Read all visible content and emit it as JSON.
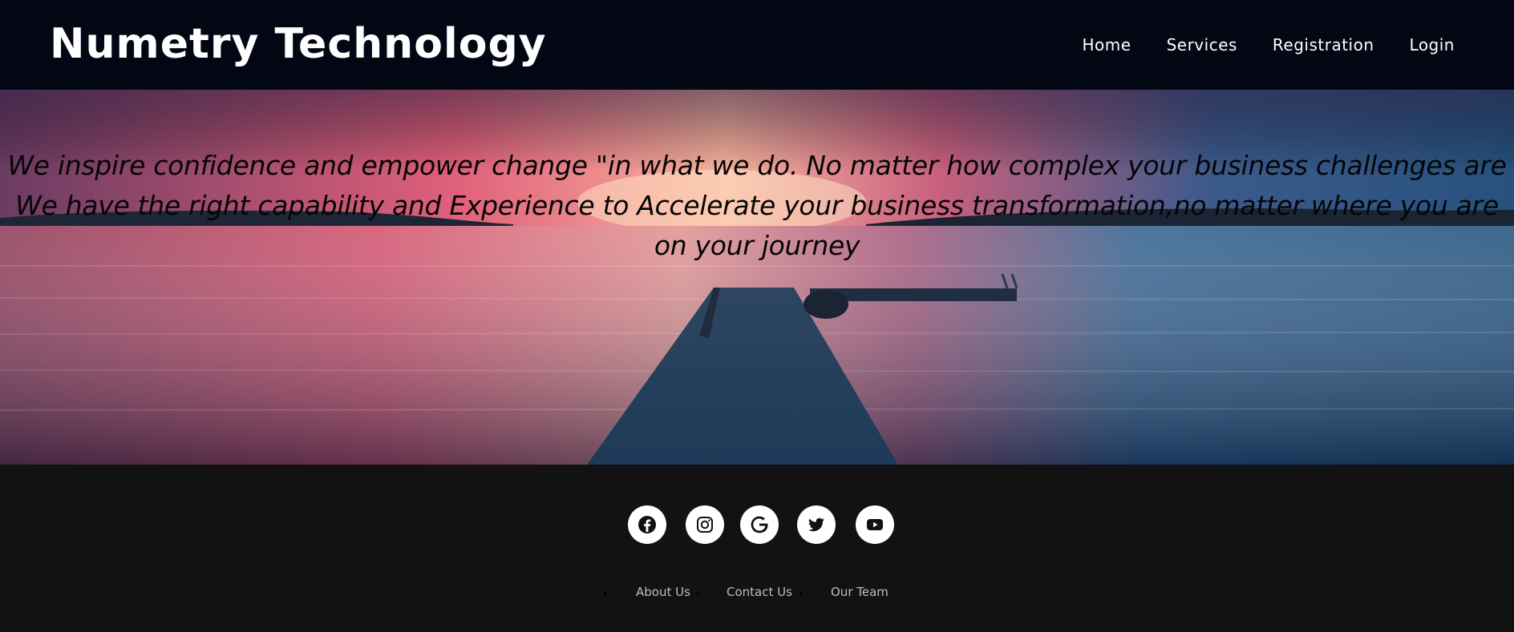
{
  "header": {
    "brand": "Numetry Technology",
    "nav": [
      "Home",
      "Services",
      "Registration",
      "Login"
    ]
  },
  "hero": {
    "lines": [
      "We inspire confidence and empower change \"in what we do. No matter how complex your business challenges are",
      "We have the right capability and Experience to Accelerate your business transformation,no matter where you are",
      "on your journey"
    ]
  },
  "footer": {
    "social": [
      "facebook-icon",
      "instagram-icon",
      "google-icon",
      "twitter-icon",
      "youtube-icon"
    ],
    "links": [
      "About Us",
      "Contact Us",
      "Our Team"
    ]
  }
}
